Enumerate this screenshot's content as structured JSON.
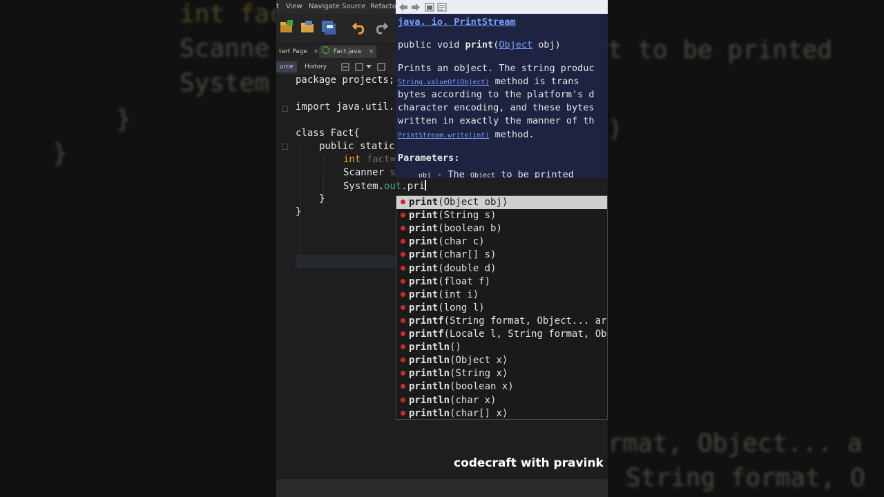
{
  "background_left": [
    "int fac",
    "Scanne",
    "System",
    "}",
    "}"
  ],
  "background_right": [
    "t to be printed",
    ")",
    "rmat, Object... a",
    "String format, O"
  ],
  "menu": [
    "t",
    "View",
    "Navigate",
    "Source",
    "Refactor"
  ],
  "tabs": {
    "start": "tart Page",
    "file": "Fact.java",
    "close": "×"
  },
  "subbar": {
    "source": "urce",
    "history": "History"
  },
  "code": {
    "l1": "package projects;",
    "l2": "import java.util.",
    "l3": "class Fact{",
    "l4": "public static",
    "l5a": "int",
    "l5b": "fact=",
    "l6a": "Scanner",
    "l6b": "s",
    "l7a": "System.",
    "l7b": "out",
    "l7c": ".pri",
    "l8": "}",
    "l9": "}"
  },
  "doc": {
    "class_link": "java. io. PrintStream",
    "sig_prefix": "public void ",
    "sig_method": "print",
    "sig_open": "(",
    "sig_type": "Object",
    "sig_rest": " obj)",
    "p1": "Prints an object. The string produc",
    "p2_link": "String.valueOf(Object)",
    "p2_rest": " method is trans",
    "p3": "bytes according to the platform's d",
    "p4": "character encoding, and these bytes",
    "p5": "written in exactly the manner of th",
    "p6_link": "PrintStream.write(int)",
    "p6_rest": " method.",
    "params_label": "Parameters:",
    "param_name": "obj",
    "param_mid": " - The ",
    "param_type": "Object",
    "param_rest": " to be printed"
  },
  "completions": [
    {
      "name": "print",
      "args": "(Object obj)"
    },
    {
      "name": "print",
      "args": "(String s)"
    },
    {
      "name": "print",
      "args": "(boolean b)"
    },
    {
      "name": "print",
      "args": "(char c)"
    },
    {
      "name": "print",
      "args": "(char[] s)"
    },
    {
      "name": "print",
      "args": "(double d)"
    },
    {
      "name": "print",
      "args": "(float f)"
    },
    {
      "name": "print",
      "args": "(int i)"
    },
    {
      "name": "print",
      "args": "(long l)"
    },
    {
      "name": "printf",
      "args": "(String format, Object... ar"
    },
    {
      "name": "printf",
      "args": "(Locale l, String format, Ob"
    },
    {
      "name": "println",
      "args": "()"
    },
    {
      "name": "println",
      "args": "(Object x)"
    },
    {
      "name": "println",
      "args": "(String x)"
    },
    {
      "name": "println",
      "args": "(boolean x)"
    },
    {
      "name": "println",
      "args": "(char x)"
    },
    {
      "name": "println",
      "args": "(char[] x)"
    }
  ],
  "watermark": "codecraft with pravink",
  "colors": {
    "keyword": "#e6a23c",
    "field": "#3fae8a",
    "method_dot": "#cc2a2a",
    "doc_bg": "#1d2340",
    "link": "#7aa0ff"
  }
}
